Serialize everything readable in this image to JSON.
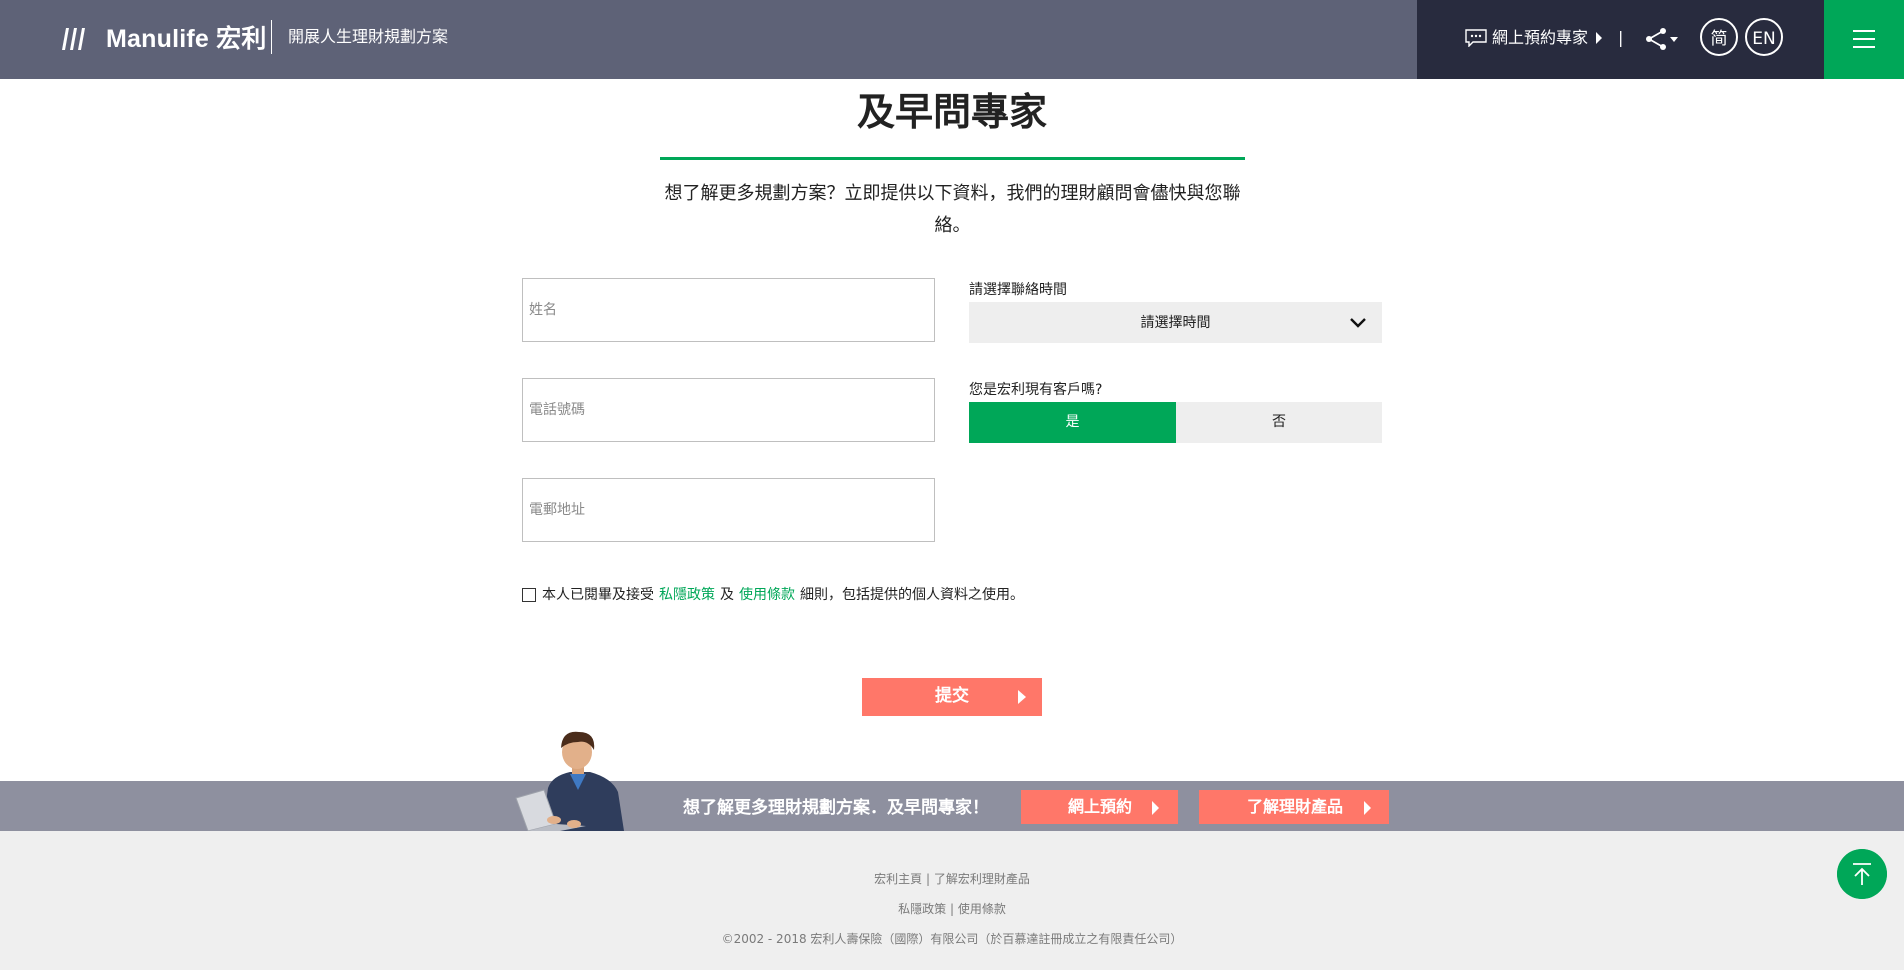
{
  "header": {
    "brand": "Manulife 宏利",
    "tagline": "開展人生理財規劃方案",
    "book_link": "網上預約專家",
    "separator": "|",
    "lang_simplified": "简",
    "lang_english": "EN"
  },
  "section": {
    "title": "及早問專家",
    "intro": "想了解更多規劃方案？立即提供以下資料，我們的理財顧問會儘快與您聯絡。"
  },
  "form": {
    "name_placeholder": "姓名",
    "phone_placeholder": "電話號碼",
    "email_placeholder": "電郵地址",
    "time_label": "請選擇聯絡時間",
    "time_value": "請選擇時間",
    "customer_label": "您是宏利現有客戶嗎?",
    "yes_label": "是",
    "no_label": "否",
    "customer_selected": "是",
    "consent_prefix": "本人已閱畢及接受",
    "privacy_link": "私隱政策",
    "consent_and": "及",
    "terms_link": "使用條款",
    "consent_suffix": "細則，包括提供的個人資料之使用。",
    "consent_checked": false,
    "submit_label": "提交"
  },
  "cta": {
    "text": "想了解更多理財規劃方案．及早問專家！",
    "book_button": "網上預約",
    "products_button": "了解理財產品"
  },
  "footer": {
    "home_link": "宏利主頁",
    "products_link": "了解宏利理財產品",
    "sep": "|",
    "privacy_link": "私隱政策",
    "terms_link": "使用條款",
    "copyright": "©2002 - 2018 宏利人壽保險（國際）有限公司（於百慕達註冊成立之有限責任公司）"
  },
  "colors": {
    "header_bg": "#5e6277",
    "header_dark": "#282b3e",
    "brand_green": "#00a758",
    "coral": "#ff7769",
    "cta_band": "#8e909f",
    "footer_bg": "#efefef"
  },
  "icons": {
    "logo": "manulife-logo-icon",
    "chat": "chat-bubble-icon",
    "share": "share-icon",
    "menu": "hamburger-menu-icon",
    "select": "chevron-down-icon",
    "back_to_top": "arrow-up-icon"
  }
}
